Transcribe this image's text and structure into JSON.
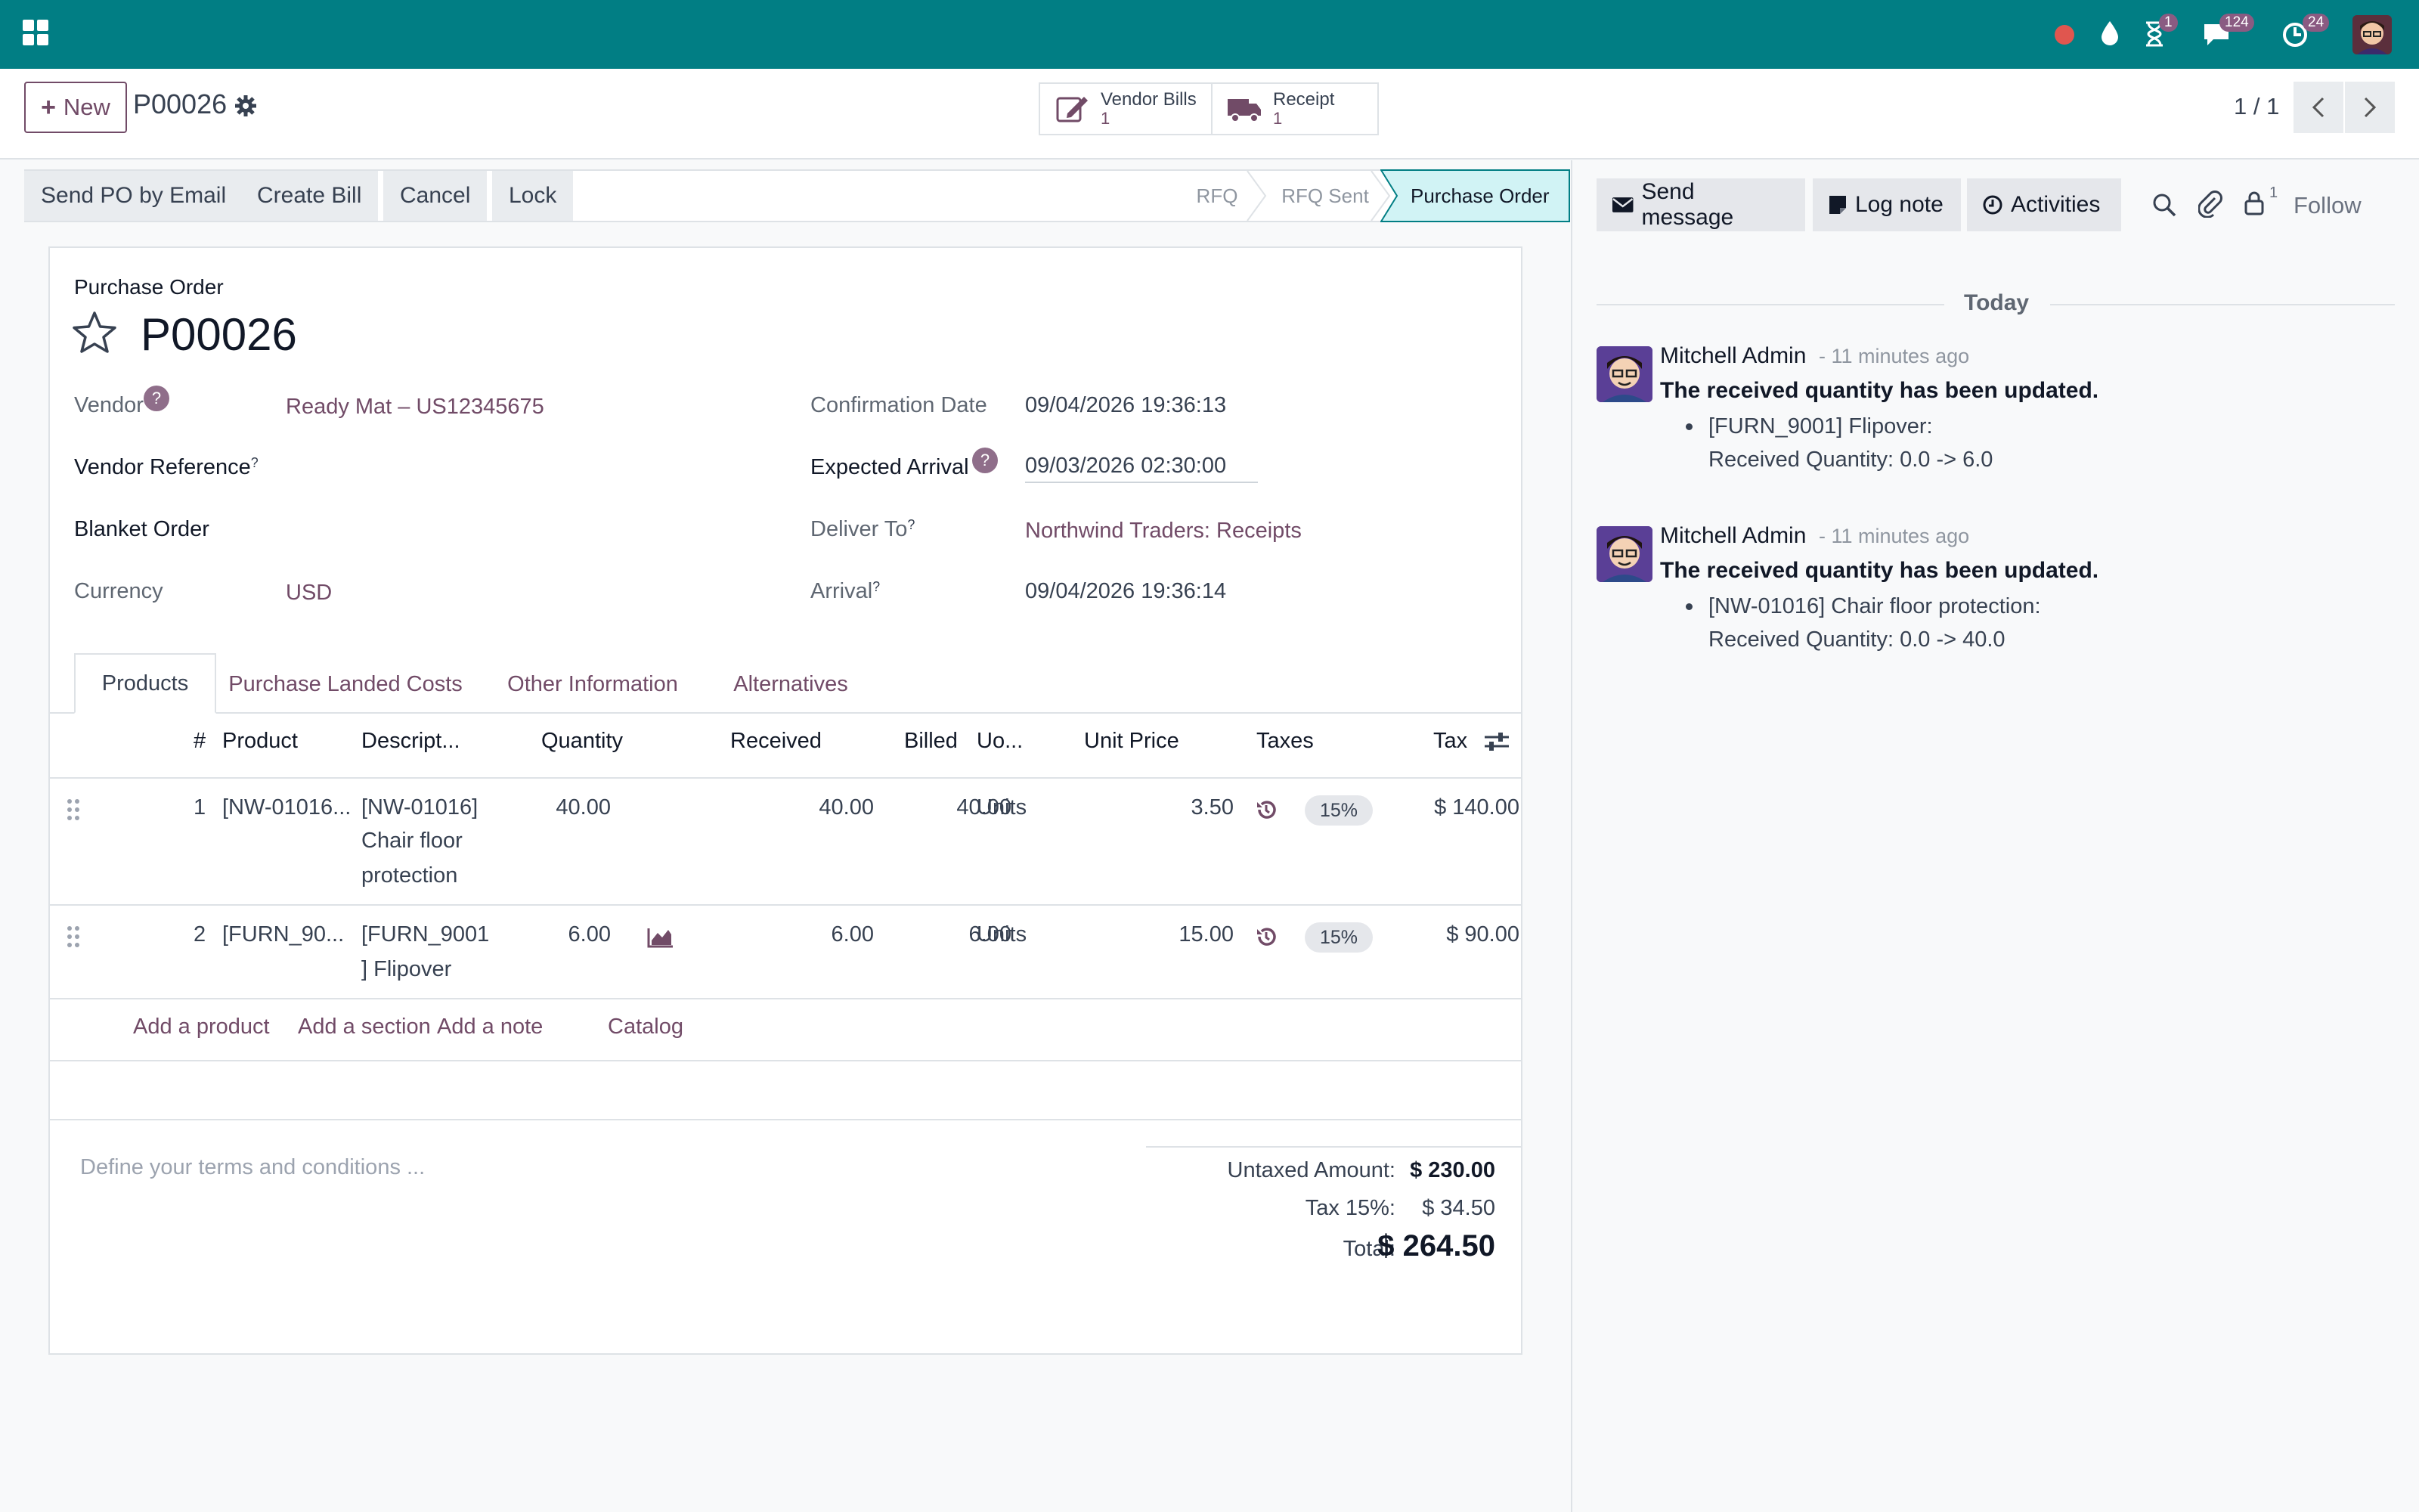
{
  "topbar": {
    "badges": {
      "activities": "1",
      "messages": "124",
      "calls": "24"
    }
  },
  "control": {
    "new_label": "New",
    "record": "P00026",
    "pager": "1 / 1",
    "smart": [
      {
        "label": "Vendor Bills",
        "count": "1"
      },
      {
        "label": "Receipt",
        "count": "1"
      }
    ]
  },
  "actions": [
    "Send PO by Email",
    "Create Bill",
    "Cancel",
    "Lock"
  ],
  "stages": [
    "RFQ",
    "RFQ Sent",
    "Purchase Order"
  ],
  "form": {
    "type_label": "Purchase Order",
    "name": "P00026",
    "vendor_label": "Vendor",
    "vendor": "Ready Mat – US12345675",
    "vendor_ref_label": "Vendor Reference",
    "blanket_label": "Blanket Order",
    "currency_label": "Currency",
    "currency": "USD",
    "confirm_label": "Confirmation Date",
    "confirm": "09/04/2026 19:36:13",
    "expected_label": "Expected Arrival",
    "expected": "09/03/2026 02:30:00",
    "deliver_label": "Deliver To",
    "deliver": "Northwind Traders: Receipts",
    "arrival_label": "Arrival",
    "arrival": "09/04/2026 19:36:14",
    "qmark": "?",
    "sup": "?"
  },
  "tabs": [
    "Products",
    "Purchase Landed Costs",
    "Other Information",
    "Alternatives"
  ],
  "table": {
    "headers": [
      "#",
      "Product",
      "Descript...",
      "Quantity",
      "Received",
      "Billed",
      "Uo...",
      "Unit Price",
      "Taxes",
      "Tax"
    ],
    "rows": [
      {
        "num": "1",
        "product": "[NW-01016...",
        "desc1": "[NW-01016]",
        "desc2": "Chair floor",
        "desc3": "protection",
        "qty": "40.00",
        "received": "40.00",
        "billed": "40.00",
        "uom": "Units",
        "price": "3.50",
        "tax": "15%",
        "total": "$ 140.00"
      },
      {
        "num": "2",
        "product": "[FURN_90...",
        "desc1": "[FURN_9001",
        "desc2": "] Flipover",
        "desc3": "",
        "qty": "6.00",
        "received": "6.00",
        "billed": "6.00",
        "uom": "Units",
        "price": "15.00",
        "tax": "15%",
        "total": "$ 90.00"
      }
    ],
    "add_links": [
      "Add a product",
      "Add a section",
      "Add a note",
      "Catalog"
    ]
  },
  "terms_placeholder": "Define your terms and conditions ...",
  "totals": {
    "untaxed_label": "Untaxed Amount:",
    "untaxed": "$ 230.00",
    "tax_label": "Tax 15%:",
    "tax": "$ 34.50",
    "total_label": "Total:",
    "total": "$ 264.50"
  },
  "chatter": {
    "send": "Send message",
    "log": "Log note",
    "activities": "Activities",
    "follower_count": "1",
    "follow": "Follow",
    "today": "Today",
    "messages": [
      {
        "author": "Mitchell Admin",
        "ago": "- 11 minutes ago",
        "title": "The received quantity has been updated.",
        "item": "[FURN_9001] Flipover:",
        "change": "Received Quantity: 0.0 -> 6.0"
      },
      {
        "author": "Mitchell Admin",
        "ago": "- 11 minutes ago",
        "title": "The received quantity has been updated.",
        "item": "[NW-01016] Chair floor protection:",
        "change": "Received Quantity: 0.0 -> 40.0"
      }
    ]
  },
  "colors": {
    "topbar": "#017e84",
    "brand": "#714b67",
    "active_stage": "#d1f3f5"
  }
}
